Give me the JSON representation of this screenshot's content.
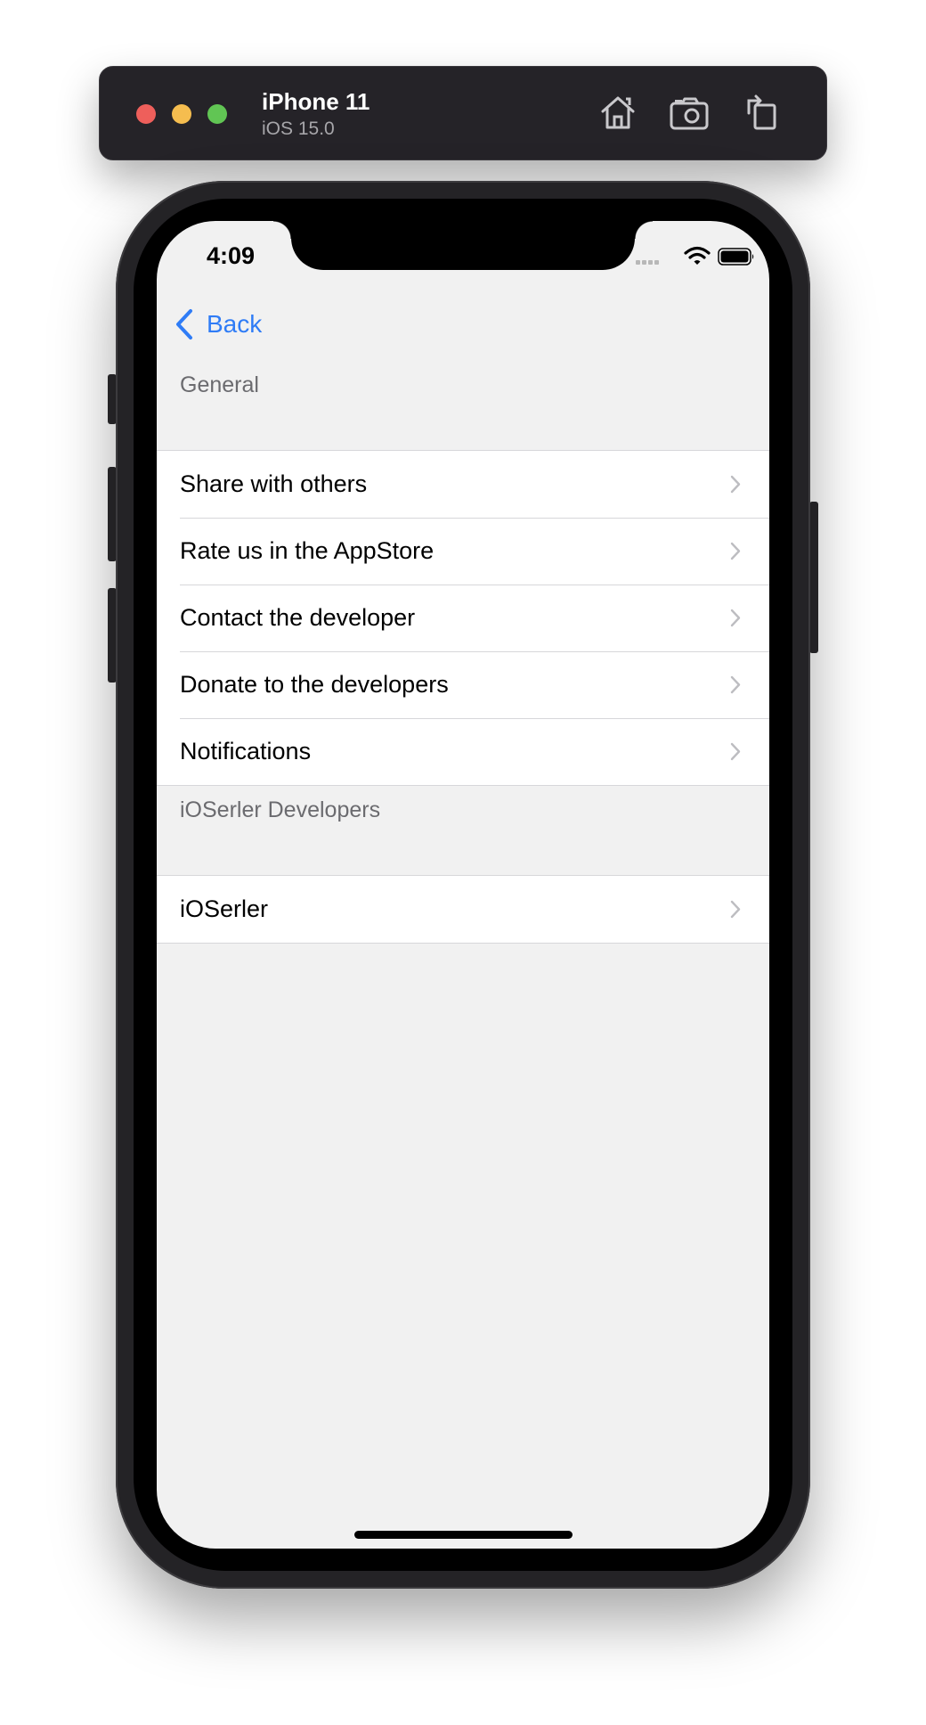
{
  "simulator": {
    "device_name": "iPhone 11",
    "os_version": "iOS 15.0",
    "toolbar_icons": [
      "home-icon",
      "screenshot-icon",
      "rotate-icon"
    ]
  },
  "status_bar": {
    "time": "4:09"
  },
  "nav": {
    "back_label": "Back",
    "accent_color": "#2f7cf6"
  },
  "sections": [
    {
      "header": "General",
      "rows": [
        {
          "label": "Share with others"
        },
        {
          "label": "Rate us in the AppStore"
        },
        {
          "label": "Contact the developer"
        },
        {
          "label": "Donate to the developers"
        },
        {
          "label": "Notifications"
        }
      ]
    },
    {
      "header": "iOSerler Developers",
      "rows": [
        {
          "label": "iOSerler"
        }
      ]
    }
  ]
}
